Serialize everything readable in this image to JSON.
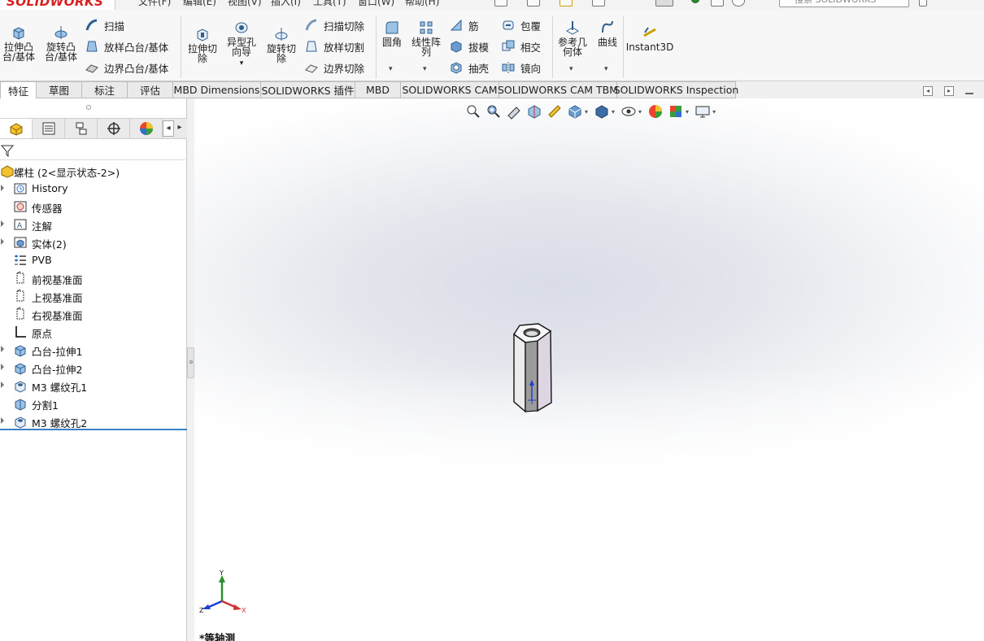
{
  "app": {
    "logo_text": "SOLIDWORKS"
  },
  "menu_partial": [
    "文件(F)",
    "编辑(E)",
    "视图(V)",
    "插入(I)",
    "工具(T)",
    "窗口(W)",
    "帮助(H)"
  ],
  "search": {
    "placeholder": "搜索 SOLIDWORKS"
  },
  "ribbon": {
    "extrude_boss": "拉伸凸\n台/基体",
    "revolve_boss": "旋转凸\n台/基体",
    "sweep": "扫描",
    "loft_boss": "放样凸台/基体",
    "boundary_boss": "边界凸台/基体",
    "extrude_cut": "拉伸切\n除",
    "hole_wizard": "异型孔\n向导",
    "revolve_cut": "旋转切\n除",
    "swept_cut": "扫描切除",
    "lofted_cut": "放样切割",
    "boundary_cut": "边界切除",
    "fillet": "圆角",
    "linear_pattern": "线性阵\n列",
    "rib": "筋",
    "draft": "拔模",
    "shell": "抽壳",
    "wrap": "包覆",
    "intersect": "相交",
    "mirror": "镜向",
    "ref_geometry": "参考几\n何体",
    "curves": "曲线",
    "instant3d": "Instant3D"
  },
  "tabs": [
    {
      "label": "特征",
      "active": true
    },
    {
      "label": "草图"
    },
    {
      "label": "标注"
    },
    {
      "label": "评估"
    },
    {
      "label": "MBD Dimensions"
    },
    {
      "label": "SOLIDWORKS 插件"
    },
    {
      "label": "MBD"
    },
    {
      "label": "SOLIDWORKS CAM"
    },
    {
      "label": "SOLIDWORKS CAM TBM"
    },
    {
      "label": "SOLIDWORKS Inspection"
    }
  ],
  "tree": {
    "root": "螺柱  (2<显示状态-2>)",
    "items": [
      {
        "label": "History",
        "icon": "history-icon",
        "expandable": true
      },
      {
        "label": "传感器",
        "icon": "sensor-icon",
        "expandable": false
      },
      {
        "label": "注解",
        "icon": "annotation-icon",
        "expandable": true
      },
      {
        "label": "实体(2)",
        "icon": "solid-bodies-icon",
        "expandable": true
      },
      {
        "label": "PVB",
        "icon": "material-icon",
        "expandable": false
      },
      {
        "label": "前视基准面",
        "icon": "plane-icon",
        "expandable": false
      },
      {
        "label": "上视基准面",
        "icon": "plane-icon",
        "expandable": false
      },
      {
        "label": "右视基准面",
        "icon": "plane-icon",
        "expandable": false
      },
      {
        "label": "原点",
        "icon": "origin-icon",
        "expandable": false
      },
      {
        "label": "凸台-拉伸1",
        "icon": "boss-extrude-icon",
        "expandable": true
      },
      {
        "label": "凸台-拉伸2",
        "icon": "boss-extrude-icon",
        "expandable": true
      },
      {
        "label": "M3 螺纹孔1",
        "icon": "hole-icon",
        "expandable": true
      },
      {
        "label": "分割1",
        "icon": "split-icon",
        "expandable": false
      },
      {
        "label": "M3 螺纹孔2",
        "icon": "hole-icon",
        "expandable": true
      }
    ]
  },
  "viewport": {
    "view_name": "*等轴测"
  },
  "triad": {
    "x": "X",
    "y": "Y",
    "z": "Z"
  },
  "colors": {
    "accent": "#3b82c4",
    "tree_line": "#3b82c4",
    "logo_red": "#d81e1e"
  }
}
